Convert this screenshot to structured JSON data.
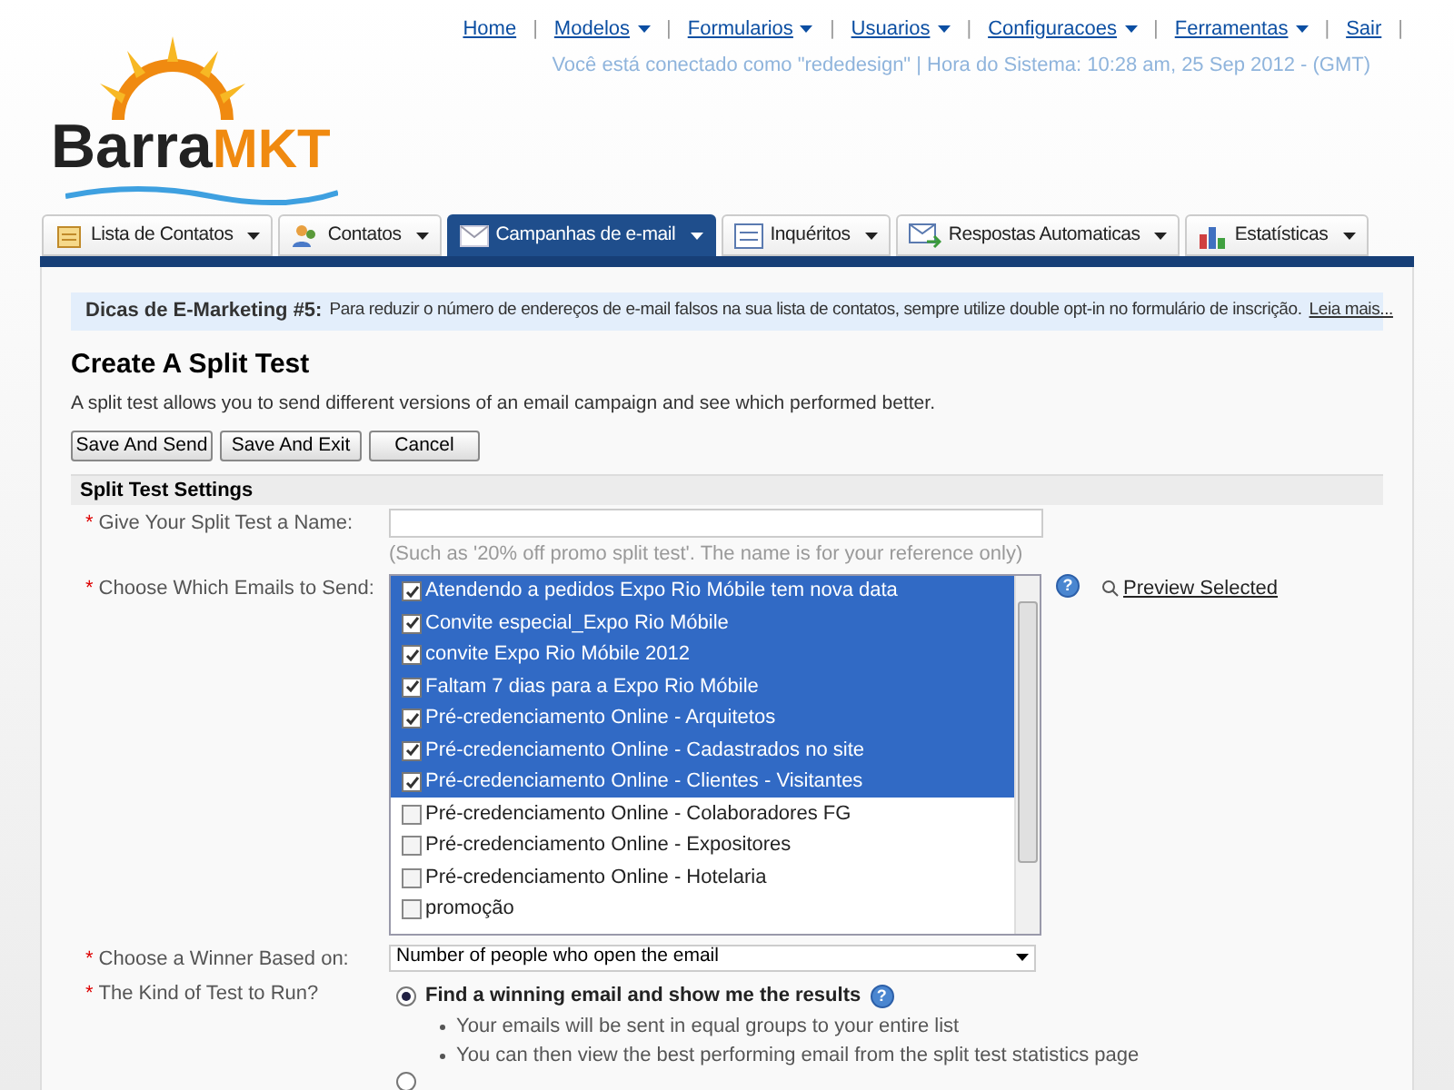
{
  "logo": {
    "text_dark": "Barra",
    "text_accent": "MKT"
  },
  "top_nav": [
    {
      "label": "Home",
      "dropdown": false
    },
    {
      "label": "Modelos",
      "dropdown": true
    },
    {
      "label": "Formularios",
      "dropdown": true
    },
    {
      "label": "Usuarios",
      "dropdown": true
    },
    {
      "label": "Configuracoes",
      "dropdown": true
    },
    {
      "label": "Ferramentas",
      "dropdown": true
    },
    {
      "label": "Sair",
      "dropdown": false
    }
  ],
  "separator": "|",
  "status_line": "Você está conectado como \"rededesign\" | Hora do Sistema: 10:28 am, 25 Sep 2012 - (GMT)",
  "tabs": [
    {
      "label": "Lista de Contatos",
      "selected": false
    },
    {
      "label": "Contatos",
      "selected": false
    },
    {
      "label": "Campanhas de e-mail",
      "selected": true
    },
    {
      "label": "Inquéritos",
      "selected": false
    },
    {
      "label": "Respostas Automaticas",
      "selected": false
    },
    {
      "label": "Estatísticas",
      "selected": false
    }
  ],
  "help_mark": "?",
  "tip": {
    "title": "Dicas de E-Marketing #5:",
    "text": "Para reduzir o número de endereços de e-mail falsos na sua lista de contatos, sempre utilize double opt-in no formulário de inscrição.",
    "link": "Leia mais..."
  },
  "heading": "Create A Split Test",
  "intro": "A split test allows you to send different versions of an email campaign and see which performed better.",
  "buttons": [
    "Save And Send",
    "Save And Exit",
    "Cancel"
  ],
  "section_title": "Split Test Settings",
  "required_marker": "*",
  "name_field": {
    "label": "Give Your Split Test a Name:",
    "hint": "(Such as '20% off promo split test'. The name is for your reference only)"
  },
  "emails": {
    "label": "Choose Which Emails to Send:",
    "preview_link": "Preview Selected",
    "items": [
      {
        "label": "Atendendo a pedidos Expo Rio Móbile tem nova data",
        "checked": true
      },
      {
        "label": "Convite especial_Expo Rio Móbile",
        "checked": true
      },
      {
        "label": "convite Expo Rio Móbile 2012",
        "checked": true
      },
      {
        "label": "Faltam 7 dias para a Expo Rio Móbile",
        "checked": true
      },
      {
        "label": "Pré-credenciamento Online - Arquitetos",
        "checked": true
      },
      {
        "label": "Pré-credenciamento Online - Cadastrados no site",
        "checked": true
      },
      {
        "label": "Pré-credenciamento Online - Clientes - Visitantes",
        "checked": true
      },
      {
        "label": "Pré-credenciamento Online - Colaboradores FG",
        "checked": false
      },
      {
        "label": "Pré-credenciamento Online - Expositores",
        "checked": false
      },
      {
        "label": "Pré-credenciamento Online - Hotelaria",
        "checked": false
      },
      {
        "label": "promoção",
        "checked": false
      }
    ]
  },
  "winner": {
    "label": "Choose a Winner Based on:",
    "value": "Number of people who open the email"
  },
  "test_kind": {
    "label": "The Kind of Test to Run?",
    "options": [
      {
        "label": "Find a winning email and show me the results",
        "selected": true,
        "bullets": [
          "Your emails will be sent in equal groups to your entire list",
          "You can then view the best performing email from the split test statistics page"
        ]
      },
      {
        "selected": false
      }
    ]
  }
}
